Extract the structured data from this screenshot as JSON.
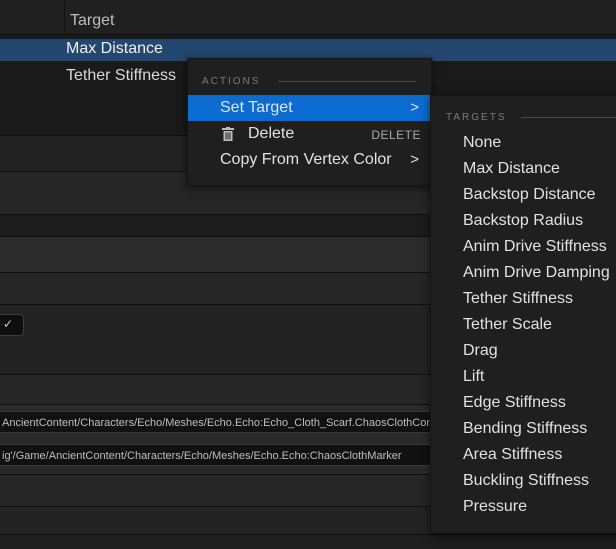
{
  "table": {
    "column_header": "Target",
    "rows": [
      "Max Distance",
      "Tether Stiffness"
    ]
  },
  "property_panel": {
    "path1": "AncientContent/Characters/Echo/Meshes/Echo.Echo:Echo_Cloth_Scarf.ChaosClothConfig",
    "path2": "ig'/Game/AncientContent/Characters/Echo/Meshes/Echo.Echo:ChaosClothMarker"
  },
  "context_menu": {
    "section": "ACTIONS",
    "items": [
      {
        "label": "Set Target",
        "arrow": ">",
        "highlighted": true
      },
      {
        "label": "Delete",
        "shortcut": "DELETE",
        "icon": "trash-icon"
      },
      {
        "label": "Copy From Vertex Color",
        "arrow": ">"
      }
    ]
  },
  "submenu": {
    "section": "TARGETS",
    "items": [
      "None",
      "Max Distance",
      "Backstop Distance",
      "Backstop Radius",
      "Anim Drive Stiffness",
      "Anim Drive Damping",
      "Tether Stiffness",
      "Tether Scale",
      "Drag",
      "Lift",
      "Edge Stiffness",
      "Bending Stiffness",
      "Area Stiffness",
      "Buckling Stiffness",
      "Pressure"
    ]
  },
  "colors": {
    "highlight": "#0c6bd0",
    "selected_row": "#23476e",
    "menu_bg": "#1f1f1f"
  }
}
